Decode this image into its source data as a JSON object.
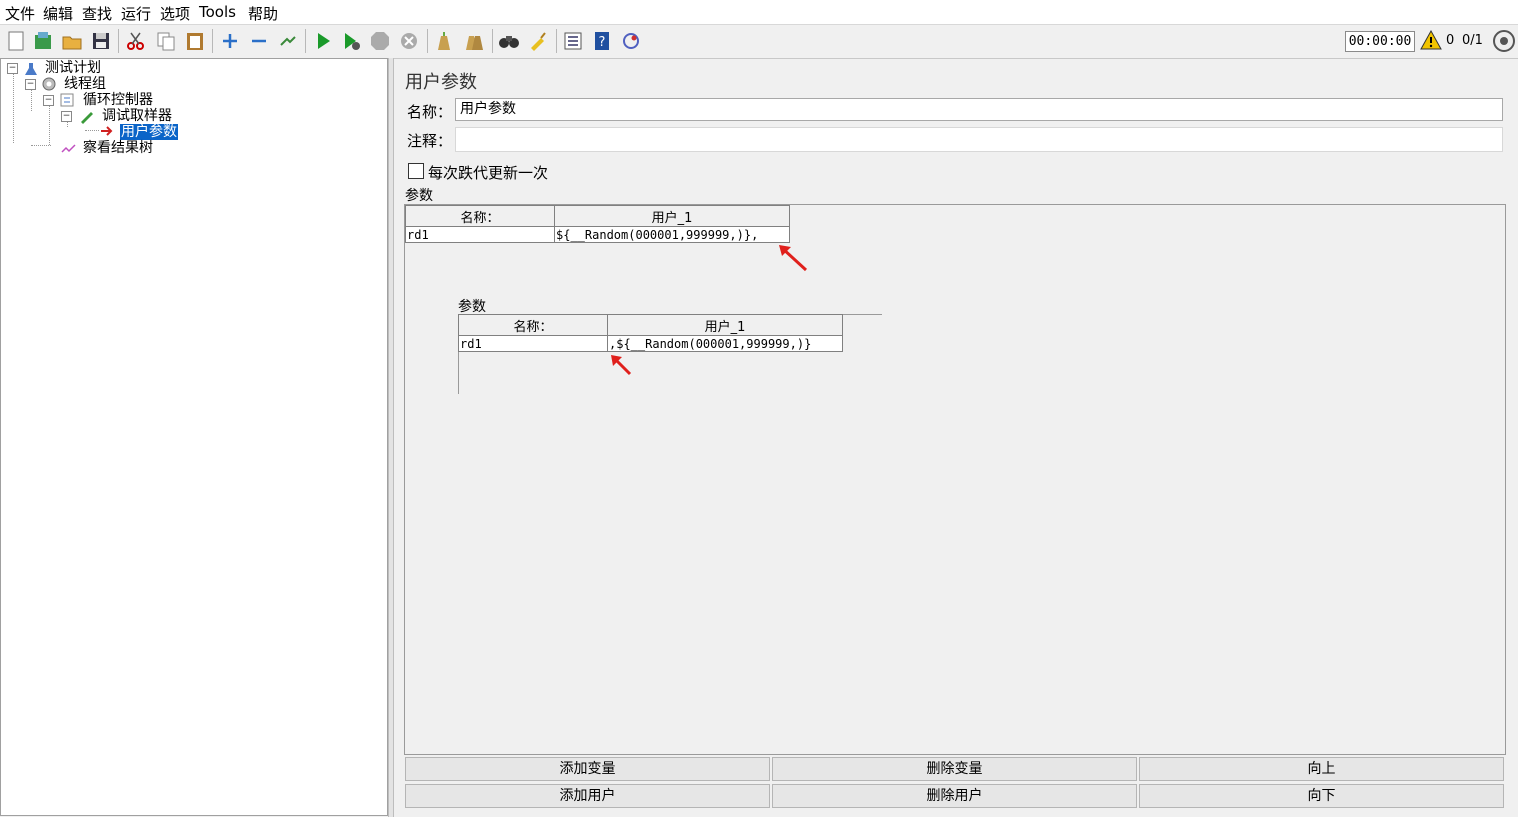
{
  "menu": [
    "文件",
    "编辑",
    "查找",
    "运行",
    "选项",
    "Tools",
    "帮助"
  ],
  "toolbar": {
    "icons": [
      "new-icon",
      "templates-icon",
      "open-icon",
      "save-icon",
      "cut-icon",
      "copy-icon",
      "paste-icon",
      "expand-icon",
      "collapse-icon",
      "toggle-icon",
      "start-icon",
      "start-no-pause-icon",
      "stop-icon",
      "shutdown-icon",
      "clear-icon",
      "clear-all-icon",
      "search-icon",
      "reset-search-icon",
      "function-helper-icon",
      "help-icon",
      "remote-icon"
    ],
    "timer": "00:00:00",
    "warning_count": "0",
    "threads": "0/1"
  },
  "tree": {
    "nodes": [
      {
        "label": "测试计划"
      },
      {
        "label": "线程组"
      },
      {
        "label": "循环控制器"
      },
      {
        "label": "调试取样器"
      },
      {
        "label": "用户参数",
        "selected": true
      },
      {
        "label": "察看结果树"
      }
    ]
  },
  "panel": {
    "title": "用户参数",
    "name_label": "名称：",
    "name_value": "用户参数",
    "comment_label": "注释：",
    "comment_value": "",
    "checkbox_label": "每次跌代更新一次",
    "checkbox_checked": false,
    "params_label": "参数"
  },
  "table1": {
    "headers": [
      "名称：",
      "用户_1"
    ],
    "rows": [
      [
        "rd1",
        "${__Random(000001,999999,)},"
      ]
    ]
  },
  "table2": {
    "label": "参数",
    "headers": [
      "名称：",
      "用户_1"
    ],
    "rows": [
      [
        "rd1",
        ",${__Random(000001,999999,)}"
      ]
    ]
  },
  "buttons": {
    "add_var": "添加变量",
    "del_var": "删除变量",
    "up": "向上",
    "add_user": "添加用户",
    "del_user": "删除用户",
    "down": "向下"
  },
  "colors": {
    "selection": "#0a64c8",
    "annotation_arrow": "#e0201c"
  }
}
